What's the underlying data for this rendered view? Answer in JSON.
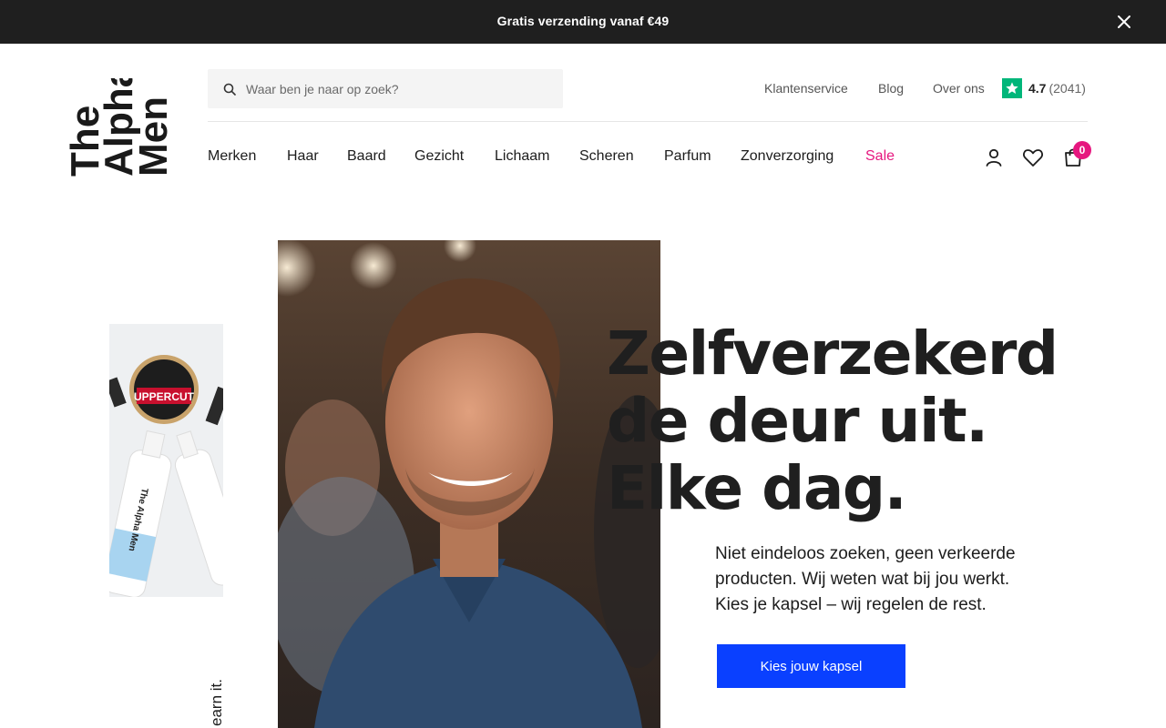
{
  "announcement": {
    "text": "Gratis verzending vanaf €49",
    "close_icon": "close-icon"
  },
  "logo": {
    "lines": [
      "The",
      "Alpha",
      "Men"
    ]
  },
  "search": {
    "placeholder": "Waar ben je naar op zoek?",
    "value": "",
    "icon": "search-icon"
  },
  "top_links": [
    {
      "label": "Klantenservice"
    },
    {
      "label": "Blog"
    },
    {
      "label": "Over ons"
    }
  ],
  "rating": {
    "score": "4.7",
    "count": "(2041)",
    "icon": "trustpilot-star-icon",
    "color": "#00b67a"
  },
  "nav": [
    {
      "label": "Merken"
    },
    {
      "label": "Haar"
    },
    {
      "label": "Baard"
    },
    {
      "label": "Gezicht"
    },
    {
      "label": "Lichaam"
    },
    {
      "label": "Scheren"
    },
    {
      "label": "Parfum"
    },
    {
      "label": "Zonverzorging"
    },
    {
      "label": "Sale",
      "color": "#e6177f"
    }
  ],
  "header_icons": {
    "account": "account-icon",
    "wishlist": "heart-icon",
    "cart": "cart-icon",
    "cart_count": "0"
  },
  "hero": {
    "headline": [
      "Zelfverzekerd",
      "de deur uit.",
      "Elke dag."
    ],
    "body": [
      "Niet eindeloos zoeken, geen verkeerde",
      "producten. Wij weten wat bij jou werkt.",
      "Kies je kapsel – wij regelen de rest."
    ],
    "cta_label": "Kies jouw kapsel",
    "tagline": "earn it.",
    "product_label": "UPPERCUT",
    "bottle_label": "The Alpha Men"
  },
  "colors": {
    "accent": "#0a40ff",
    "sale": "#e6177f",
    "topbar": "#1f1f1f"
  }
}
